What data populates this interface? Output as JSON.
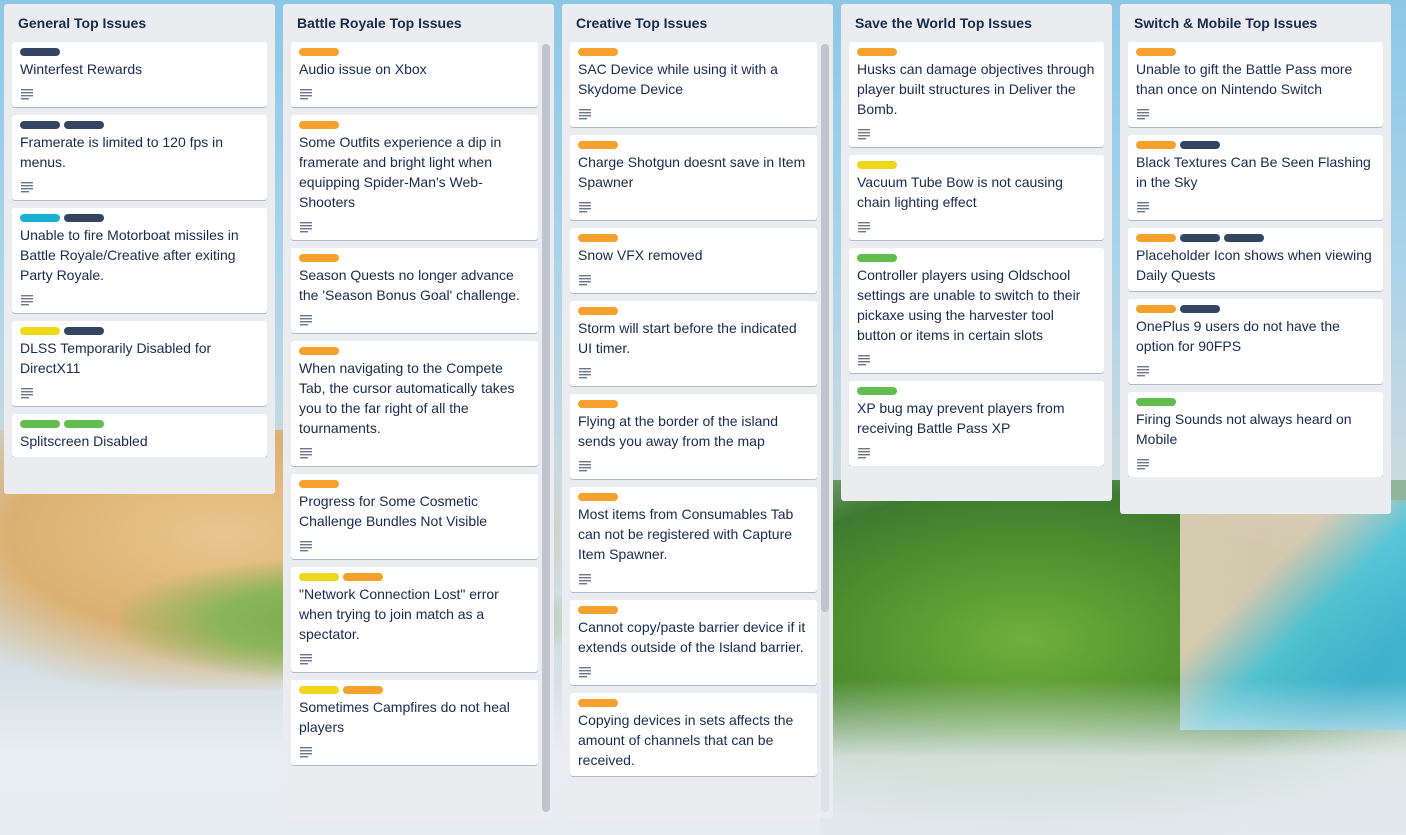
{
  "label_colors": {
    "orange": "#f6a12e",
    "navy": "#344563",
    "teal": "#18b1cf",
    "yellow": "#efd71a",
    "green": "#61bd4f"
  },
  "lists": [
    {
      "title": "General Top Issues",
      "cards": [
        {
          "labels": [
            "navy"
          ],
          "title": "Winterfest Rewards",
          "has_description": true
        },
        {
          "labels": [
            "navy",
            "navy"
          ],
          "title": "Framerate is limited to 120 fps in menus.",
          "has_description": true
        },
        {
          "labels": [
            "teal",
            "navy"
          ],
          "title": "Unable to fire Motorboat missiles in Battle Royale/Creative after exiting Party Royale.",
          "has_description": true
        },
        {
          "labels": [
            "yellow",
            "navy"
          ],
          "title": "DLSS Temporarily Disabled for DirectX11",
          "has_description": true
        },
        {
          "labels": [
            "green",
            "green"
          ],
          "title": "Splitscreen Disabled",
          "has_description": false
        }
      ]
    },
    {
      "title": "Battle Royale Top Issues",
      "cards": [
        {
          "labels": [
            "orange"
          ],
          "title": "Audio issue on Xbox",
          "has_description": true
        },
        {
          "labels": [
            "orange"
          ],
          "title": "Some Outfits experience a dip in framerate and bright light when equipping Spider-Man's Web-Shooters",
          "has_description": true
        },
        {
          "labels": [
            "orange"
          ],
          "title": "Season Quests no longer advance the 'Season Bonus Goal' challenge.",
          "has_description": true
        },
        {
          "labels": [
            "orange"
          ],
          "title": "When navigating to the Compete Tab, the cursor automatically takes you to the far right of all the tournaments.",
          "has_description": true
        },
        {
          "labels": [
            "orange"
          ],
          "title": "Progress for Some Cosmetic Challenge Bundles Not Visible",
          "has_description": true
        },
        {
          "labels": [
            "yellow",
            "orange"
          ],
          "title": "\"Network Connection Lost\" error when trying to join match as a spectator.",
          "has_description": true
        },
        {
          "labels": [
            "yellow",
            "orange"
          ],
          "title": "Sometimes Campfires do not heal players",
          "has_description": true
        }
      ]
    },
    {
      "title": "Creative Top Issues",
      "cards": [
        {
          "labels": [
            "orange"
          ],
          "title": "SAC Device while using it with a Skydome Device",
          "has_description": true
        },
        {
          "labels": [
            "orange"
          ],
          "title": "Charge Shotgun doesnt save in Item Spawner",
          "has_description": true
        },
        {
          "labels": [
            "orange"
          ],
          "title": "Snow VFX removed",
          "has_description": true
        },
        {
          "labels": [
            "orange"
          ],
          "title": "Storm will start before the indicated UI timer.",
          "has_description": true
        },
        {
          "labels": [
            "orange"
          ],
          "title": "Flying at the border of the island sends you away from the map",
          "has_description": true
        },
        {
          "labels": [
            "orange"
          ],
          "title": "Most items from Consumables Tab can not be registered with Capture Item Spawner.",
          "has_description": true
        },
        {
          "labels": [
            "orange"
          ],
          "title": "Cannot copy/paste barrier device if it extends outside of the Island barrier.",
          "has_description": true
        },
        {
          "labels": [
            "orange"
          ],
          "title": "Copying devices in sets affects the amount of channels that can be received.",
          "has_description": false
        }
      ]
    },
    {
      "title": "Save the World Top Issues",
      "cards": [
        {
          "labels": [
            "orange"
          ],
          "title": "Husks can damage objectives through player built structures in Deliver the Bomb.",
          "has_description": true
        },
        {
          "labels": [
            "yellow"
          ],
          "title": "Vacuum Tube Bow is not causing chain lighting effect",
          "has_description": true
        },
        {
          "labels": [
            "green"
          ],
          "title": "Controller players using Oldschool settings are unable to switch to their pickaxe using the harvester tool button or items in certain slots",
          "has_description": true
        },
        {
          "labels": [
            "green"
          ],
          "title": "XP bug may prevent players from receiving Battle Pass XP",
          "has_description": true
        }
      ]
    },
    {
      "title": "Switch & Mobile Top Issues",
      "cards": [
        {
          "labels": [
            "orange"
          ],
          "title": "Unable to gift the Battle Pass more than once on Nintendo Switch",
          "has_description": true
        },
        {
          "labels": [
            "orange",
            "navy"
          ],
          "title": "Black Textures Can Be Seen Flashing in the Sky",
          "has_description": true
        },
        {
          "labels": [
            "orange",
            "navy",
            "navy"
          ],
          "title": "Placeholder Icon shows when viewing Daily Quests",
          "has_description": false
        },
        {
          "labels": [
            "orange",
            "navy"
          ],
          "title": "OnePlus 9 users do not have the option for 90FPS",
          "has_description": true
        },
        {
          "labels": [
            "green"
          ],
          "title": "Firing Sounds not always heard on Mobile",
          "has_description": true
        }
      ]
    }
  ]
}
